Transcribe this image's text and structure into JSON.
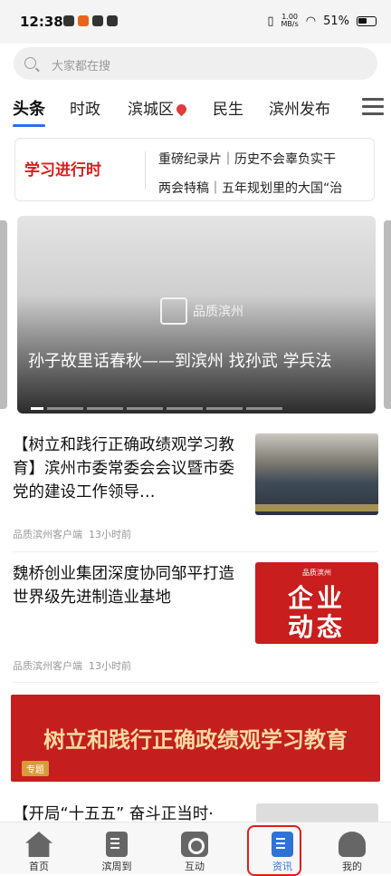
{
  "status_bar": {
    "time": "12:38",
    "speed_top": "1.00",
    "speed_bottom": "MB/s",
    "battery": "51%"
  },
  "search": {
    "placeholder": "大家都在搜"
  },
  "tabs": [
    {
      "label": "头条",
      "active": true
    },
    {
      "label": "时政"
    },
    {
      "label": "滨城区"
    },
    {
      "label": "民生"
    },
    {
      "label": "滨州发布"
    }
  ],
  "banner": {
    "logo_text": "学习进行时",
    "line1": "重磅纪录片｜历史不会辜负实干",
    "line2": "两会特稿｜五年规划里的大国“治"
  },
  "carousel": {
    "watermark": "品质滨州",
    "caption": "孙子故里话春秋——到滨州 找孙武 学兵法"
  },
  "articles": [
    {
      "title": "【树立和践行正确政绩观学习教育】滨州市委常委会会议暨市委党的建设工作领导…",
      "source": "品质滨州客户端",
      "time": "13小时前",
      "thumb": "photo"
    },
    {
      "title": "魏桥创业集团深度协同邹平打造世界级先进制造业基地",
      "source": "品质滨州客户端",
      "time": "13小时前",
      "thumb": "red",
      "thumb_brand": "品质滨州",
      "thumb_line1": "企业",
      "thumb_line2": "动态"
    }
  ],
  "promo": {
    "text": "树立和践行正确政绩观学习教育",
    "tag": "专题"
  },
  "next_title": "【开局“十五五” 奋斗正当时·",
  "bottom_nav": [
    {
      "label": "首页",
      "icon": "home-icon"
    },
    {
      "label": "滨周到",
      "icon": "profile-doc-icon"
    },
    {
      "label": "互动",
      "icon": "camera-icon"
    },
    {
      "label": "资讯",
      "icon": "news-book-icon",
      "active": true
    },
    {
      "label": "我的",
      "icon": "user-icon"
    }
  ],
  "colors": {
    "accent": "#2f73d6",
    "brand_red": "#c81e1e",
    "highlight_box": "#e21c1c"
  }
}
